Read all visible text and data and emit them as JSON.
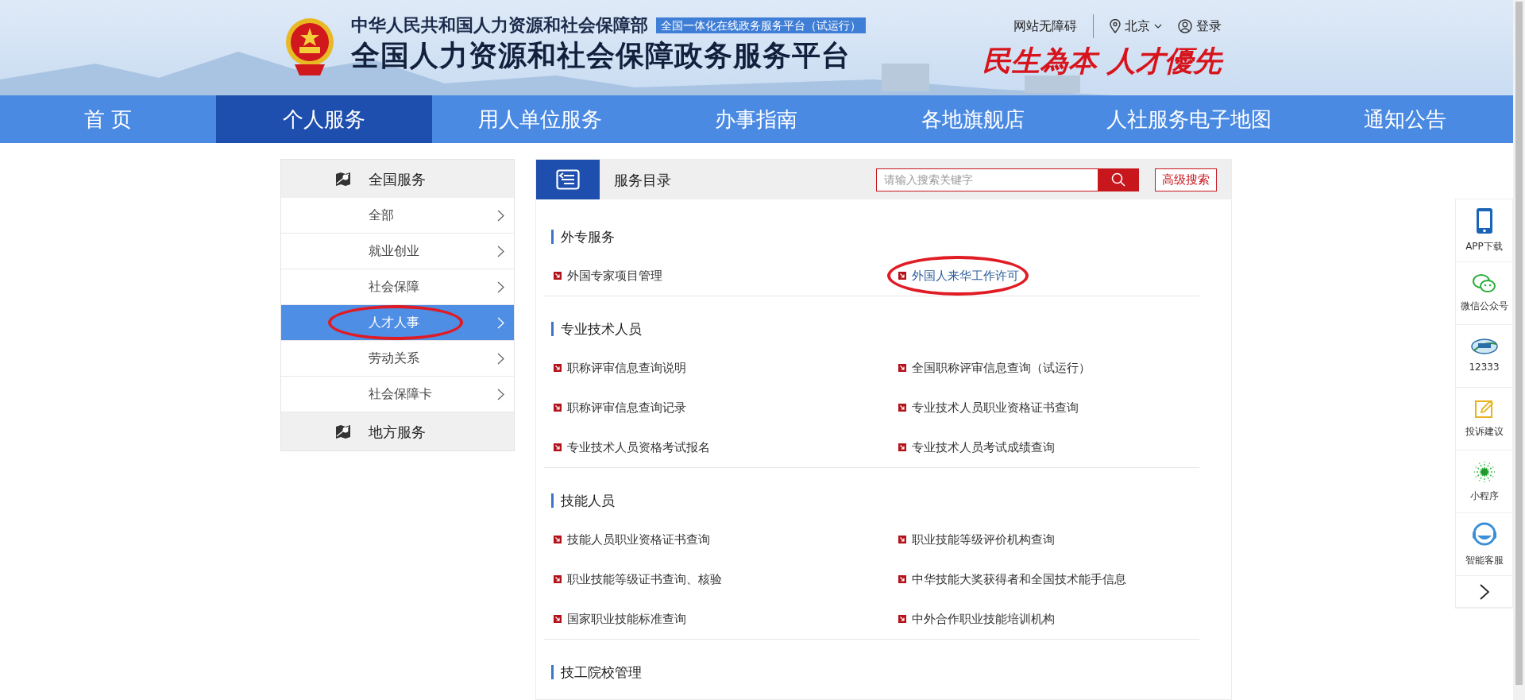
{
  "header": {
    "ministry": "中华人民共和国人力资源和社会保障部",
    "platform_badge": "全国一体化在线政务服务平台（试运行）",
    "title": "全国人力资源和社会保障政务服务平台",
    "slogan": "民生為本 人才優先",
    "accessibility": "网站无障碍",
    "location": "北京",
    "login": "登录"
  },
  "nav": [
    {
      "label": "首 页",
      "selected": false
    },
    {
      "label": "个人服务",
      "selected": true
    },
    {
      "label": "用人单位服务",
      "selected": false
    },
    {
      "label": "办事指南",
      "selected": false
    },
    {
      "label": "各地旗舰店",
      "selected": false
    },
    {
      "label": "人社服务电子地图",
      "selected": false
    },
    {
      "label": "通知公告",
      "selected": false
    }
  ],
  "sidebar": {
    "groups": [
      {
        "title": "全国服务",
        "items": [
          {
            "label": "全部",
            "selected": false,
            "circled": false
          },
          {
            "label": "就业创业",
            "selected": false,
            "circled": false
          },
          {
            "label": "社会保障",
            "selected": false,
            "circled": false
          },
          {
            "label": "人才人事",
            "selected": true,
            "circled": true
          },
          {
            "label": "劳动关系",
            "selected": false,
            "circled": false
          },
          {
            "label": "社会保障卡",
            "selected": false,
            "circled": false
          }
        ]
      },
      {
        "title": "地方服务"
      }
    ]
  },
  "catalog": {
    "title": "服务目录",
    "search": {
      "placeholder": "请输入搜索关键字"
    },
    "advanced_search": "高级搜索",
    "sections": [
      {
        "title": "外专服务",
        "items": [
          {
            "label": "外国专家项目管理",
            "circled": false
          },
          {
            "label": "外国人来华工作许可",
            "circled": true
          }
        ]
      },
      {
        "title": "专业技术人员",
        "items": [
          {
            "label": "职称评审信息查询说明",
            "circled": false
          },
          {
            "label": "全国职称评审信息查询（试运行）",
            "circled": false
          },
          {
            "label": "职称评审信息查询记录",
            "circled": false
          },
          {
            "label": "专业技术人员职业资格证书查询",
            "circled": false
          },
          {
            "label": "专业技术人员资格考试报名",
            "circled": false
          },
          {
            "label": "专业技术人员考试成绩查询",
            "circled": false
          }
        ]
      },
      {
        "title": "技能人员",
        "items": [
          {
            "label": "技能人员职业资格证书查询",
            "circled": false
          },
          {
            "label": "职业技能等级评价机构查询",
            "circled": false
          },
          {
            "label": "职业技能等级证书查询、核验",
            "circled": false
          },
          {
            "label": "中华技能大奖获得者和全国技术能手信息",
            "circled": false
          },
          {
            "label": "国家职业技能标准查询",
            "circled": false
          },
          {
            "label": "中外合作职业技能培训机构",
            "circled": false
          }
        ]
      },
      {
        "title": "技工院校管理"
      }
    ]
  },
  "float_bar": [
    {
      "kind": "app",
      "label": "APP下载"
    },
    {
      "kind": "wechat",
      "label": "微信公众号"
    },
    {
      "kind": "hotline",
      "label": "12333"
    },
    {
      "kind": "feedback",
      "label": "投诉建议"
    },
    {
      "kind": "miniprogram",
      "label": "小程序"
    },
    {
      "kind": "service",
      "label": "智能客服"
    },
    {
      "kind": "more"
    }
  ]
}
